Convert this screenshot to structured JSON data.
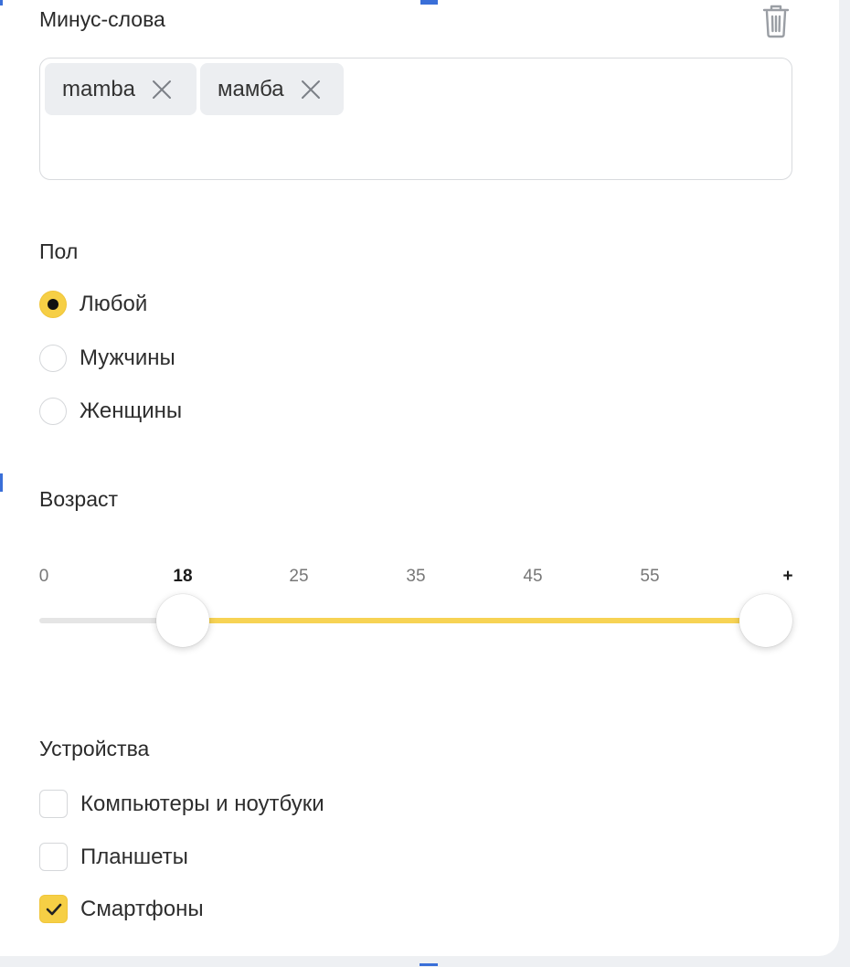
{
  "minus_words": {
    "title": "Минус-слова",
    "tags": [
      "mamba",
      "мамба"
    ]
  },
  "gender": {
    "title": "Пол",
    "options": [
      "Любой",
      "Мужчины",
      "Женщины"
    ],
    "selected_index": 0
  },
  "age": {
    "title": "Возраст",
    "scale_labels": [
      "0",
      "18",
      "25",
      "35",
      "45",
      "55",
      "+"
    ],
    "range_from": "18",
    "range_to": "+"
  },
  "devices": {
    "title": "Устройства",
    "options": [
      "Компьютеры и ноутбуки",
      "Планшеты",
      "Смартфоны"
    ],
    "checked": [
      false,
      false,
      true
    ]
  },
  "icons": {
    "delete": "trash-icon",
    "remove_tag": "close-icon",
    "checkmark": "check-icon"
  },
  "colors": {
    "accent": "#f6cf45",
    "slider_fill": "#f7d354",
    "selection_marker": "#3a6fd8"
  }
}
